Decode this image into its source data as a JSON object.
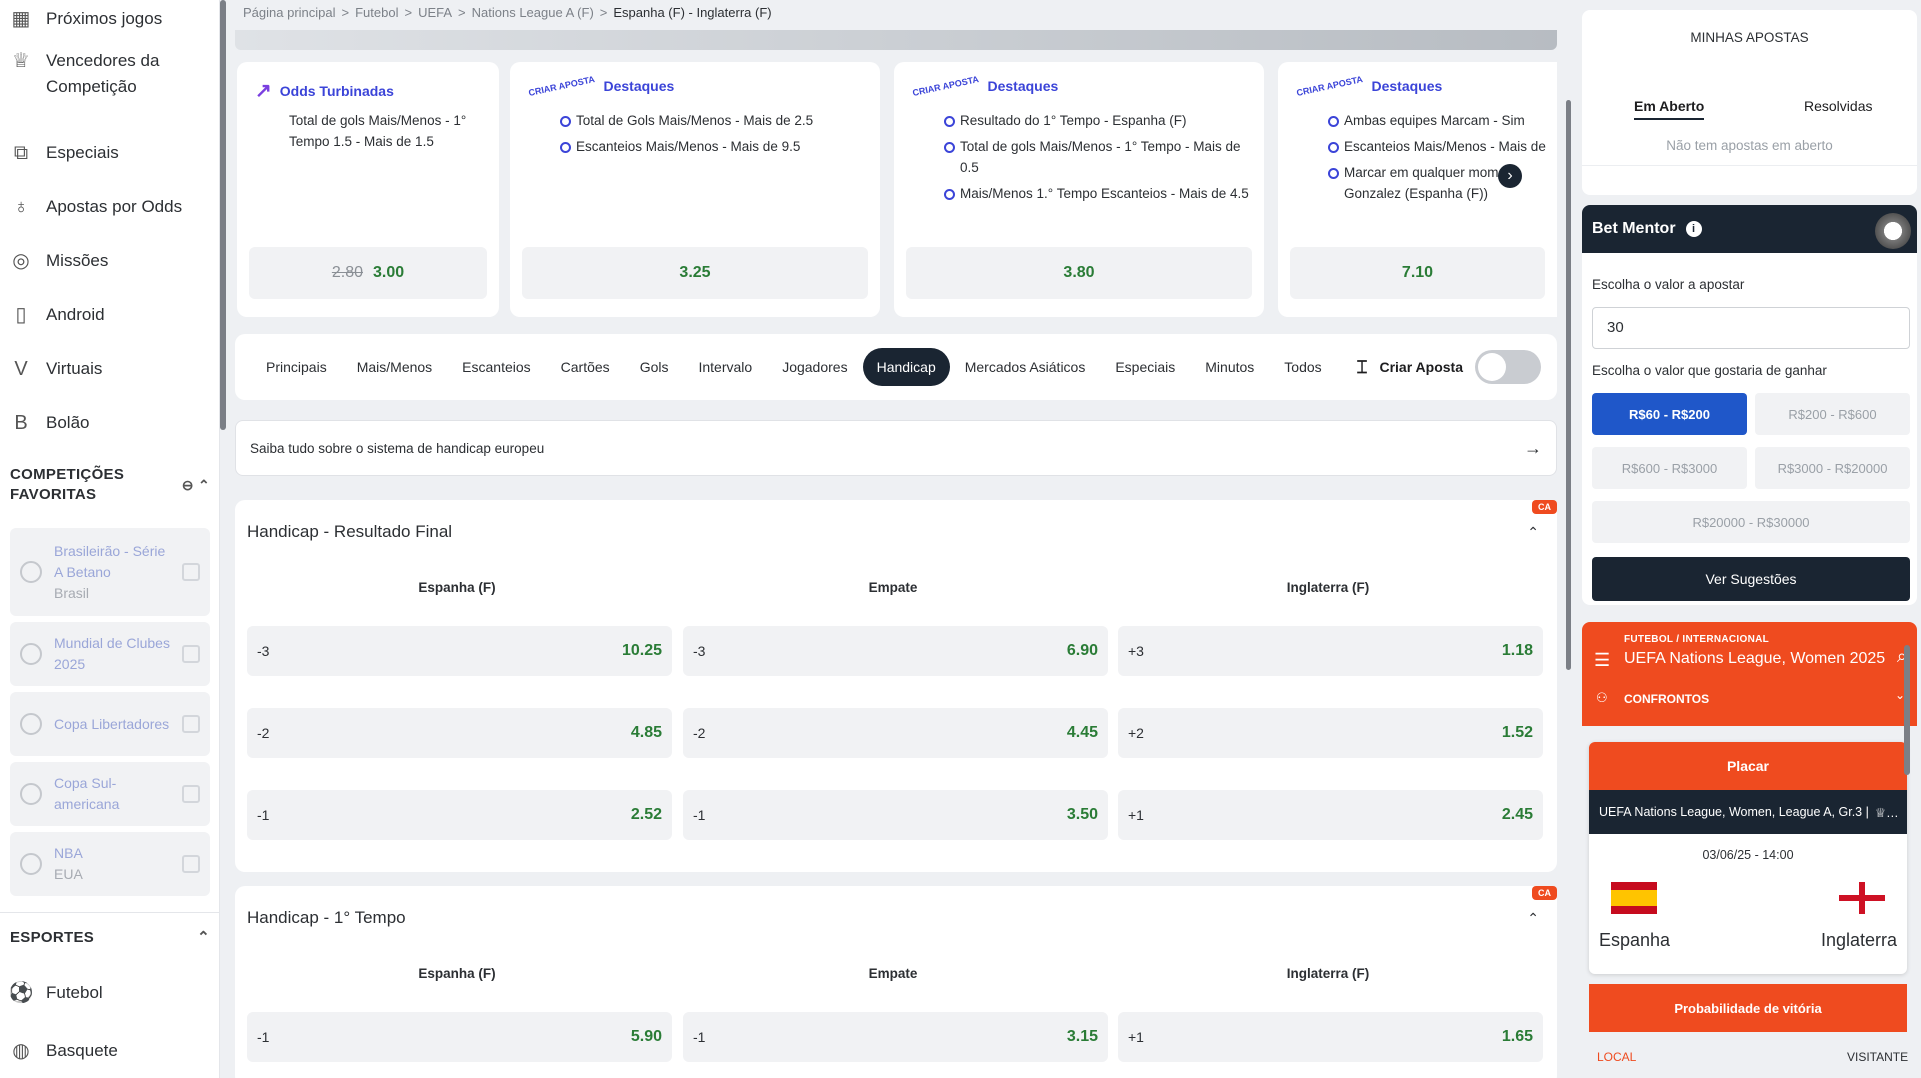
{
  "sidebar": {
    "items": [
      {
        "label": "Próximos jogos",
        "icon": "calendar-icon"
      },
      {
        "label": "Vencedores da Competição",
        "icon": "trophy-icon"
      },
      {
        "label": "Especiais",
        "icon": "special-icon"
      },
      {
        "label": "Apostas por Odds",
        "icon": "odds-icon"
      },
      {
        "label": "Missões",
        "icon": "missions-icon"
      },
      {
        "label": "Android",
        "icon": "android-icon"
      },
      {
        "label": "Virtuais",
        "icon": "virtual-icon"
      },
      {
        "label": "Bolão",
        "icon": "bolao-icon"
      }
    ],
    "favorites_title": "COMPETIÇÕES FAVORITAS",
    "favorites": [
      {
        "name": "Brasileirão - Série A Betano",
        "sub": "Brasil"
      },
      {
        "name": "Mundial de Clubes 2025",
        "sub": ""
      },
      {
        "name": "Copa Libertadores",
        "sub": ""
      },
      {
        "name": "Copa Sul-americana",
        "sub": ""
      },
      {
        "name": "NBA",
        "sub": "EUA"
      }
    ],
    "sports_title": "ESPORTES",
    "sports": [
      {
        "label": "Futebol",
        "icon": "soccer-icon"
      },
      {
        "label": "Basquete",
        "icon": "basketball-icon"
      }
    ]
  },
  "breadcrumb": [
    "Página principal",
    "Futebol",
    "UEFA",
    "Nations League A (F)",
    "Espanha (F) - Inglaterra (F)"
  ],
  "boosts": [
    {
      "header": "Odds Turbinadas",
      "lines": [
        "Total de gols Mais/Menos - 1° Tempo 1.5 - Mais de 1.5"
      ],
      "old_odd": "2.80",
      "odd": "3.00"
    },
    {
      "header": "Destaques",
      "lines": [
        "Total de Gols Mais/Menos - Mais de 2.5",
        "Escanteios Mais/Menos - Mais de 9.5"
      ],
      "odd": "3.25"
    },
    {
      "header": "Destaques",
      "lines": [
        "Resultado do 1° Tempo - Espanha (F)",
        "Total de gols Mais/Menos - 1° Tempo - Mais de 0.5",
        "Mais/Menos 1.° Tempo Escanteios - Mais de 4.5"
      ],
      "odd": "3.80"
    },
    {
      "header": "Destaques",
      "lines": [
        "Ambas equipes Marcam - Sim",
        "Escanteios Mais/Menos - Mais de",
        "Marcar em qualquer mome... Gonzalez (Espanha (F))"
      ],
      "odd": "7.10"
    }
  ],
  "criar_aposta_badge": "CRIAR APOSTA",
  "tabs": [
    "Principais",
    "Mais/Menos",
    "Escanteios",
    "Cartões",
    "Gols",
    "Intervalo",
    "Jogadores",
    "Handicap",
    "Mercados Asiáticos",
    "Especiais",
    "Minutos",
    "Todos"
  ],
  "active_tab": "Handicap",
  "criar_aposta_label": "Criar Aposta",
  "info_text": "Saiba tudo sobre o sistema de handicap europeu",
  "markets": [
    {
      "title": "Handicap - Resultado Final",
      "badge": "CA",
      "columns": [
        "Espanha (F)",
        "Empate",
        "Inglaterra (F)"
      ],
      "rows": [
        [
          {
            "line": "-3",
            "odd": "10.25"
          },
          {
            "line": "-3",
            "odd": "6.90"
          },
          {
            "line": "+3",
            "odd": "1.18"
          }
        ],
        [
          {
            "line": "-2",
            "odd": "4.85"
          },
          {
            "line": "-2",
            "odd": "4.45"
          },
          {
            "line": "+2",
            "odd": "1.52"
          }
        ],
        [
          {
            "line": "-1",
            "odd": "2.52"
          },
          {
            "line": "-1",
            "odd": "3.50"
          },
          {
            "line": "+1",
            "odd": "2.45"
          }
        ]
      ]
    },
    {
      "title": "Handicap - 1° Tempo",
      "badge": "CA",
      "columns": [
        "Espanha (F)",
        "Empate",
        "Inglaterra (F)"
      ],
      "rows": [
        [
          {
            "line": "-1",
            "odd": "5.90"
          },
          {
            "line": "-1",
            "odd": "3.15"
          },
          {
            "line": "+1",
            "odd": "1.65"
          }
        ]
      ]
    }
  ],
  "my_bets": {
    "title": "MINHAS APOSTAS",
    "tab_open": "Em Aberto",
    "tab_resolved": "Resolvidas",
    "empty": "Não tem apostas em aberto"
  },
  "mentor": {
    "title": "Bet Mentor",
    "amount_label": "Escolha o valor a apostar",
    "amount_value": "30",
    "win_label": "Escolha o valor que gostaria de ganhar",
    "ranges": [
      "R$60 - R$200",
      "R$200 - R$600",
      "R$600 - R$3000",
      "R$3000 - R$20000",
      "R$20000 - R$30000"
    ],
    "active_range": "R$60 - R$200",
    "button": "Ver Sugestões"
  },
  "widget": {
    "kicker": "FUTEBOL / INTERNACIONAL",
    "name": "UEFA Nations League, Women 2025",
    "confrontos": "CONFRONTOS",
    "placar": "Placar",
    "competition": "UEFA Nations League, Women, League A, Gr.3 |",
    "datetime": "03/06/25 - 14:00",
    "home": "Espanha",
    "away": "Inglaterra",
    "prob_label": "Probabilidade de vitória",
    "local": "LOCAL",
    "visitante": "VISITANTE"
  }
}
